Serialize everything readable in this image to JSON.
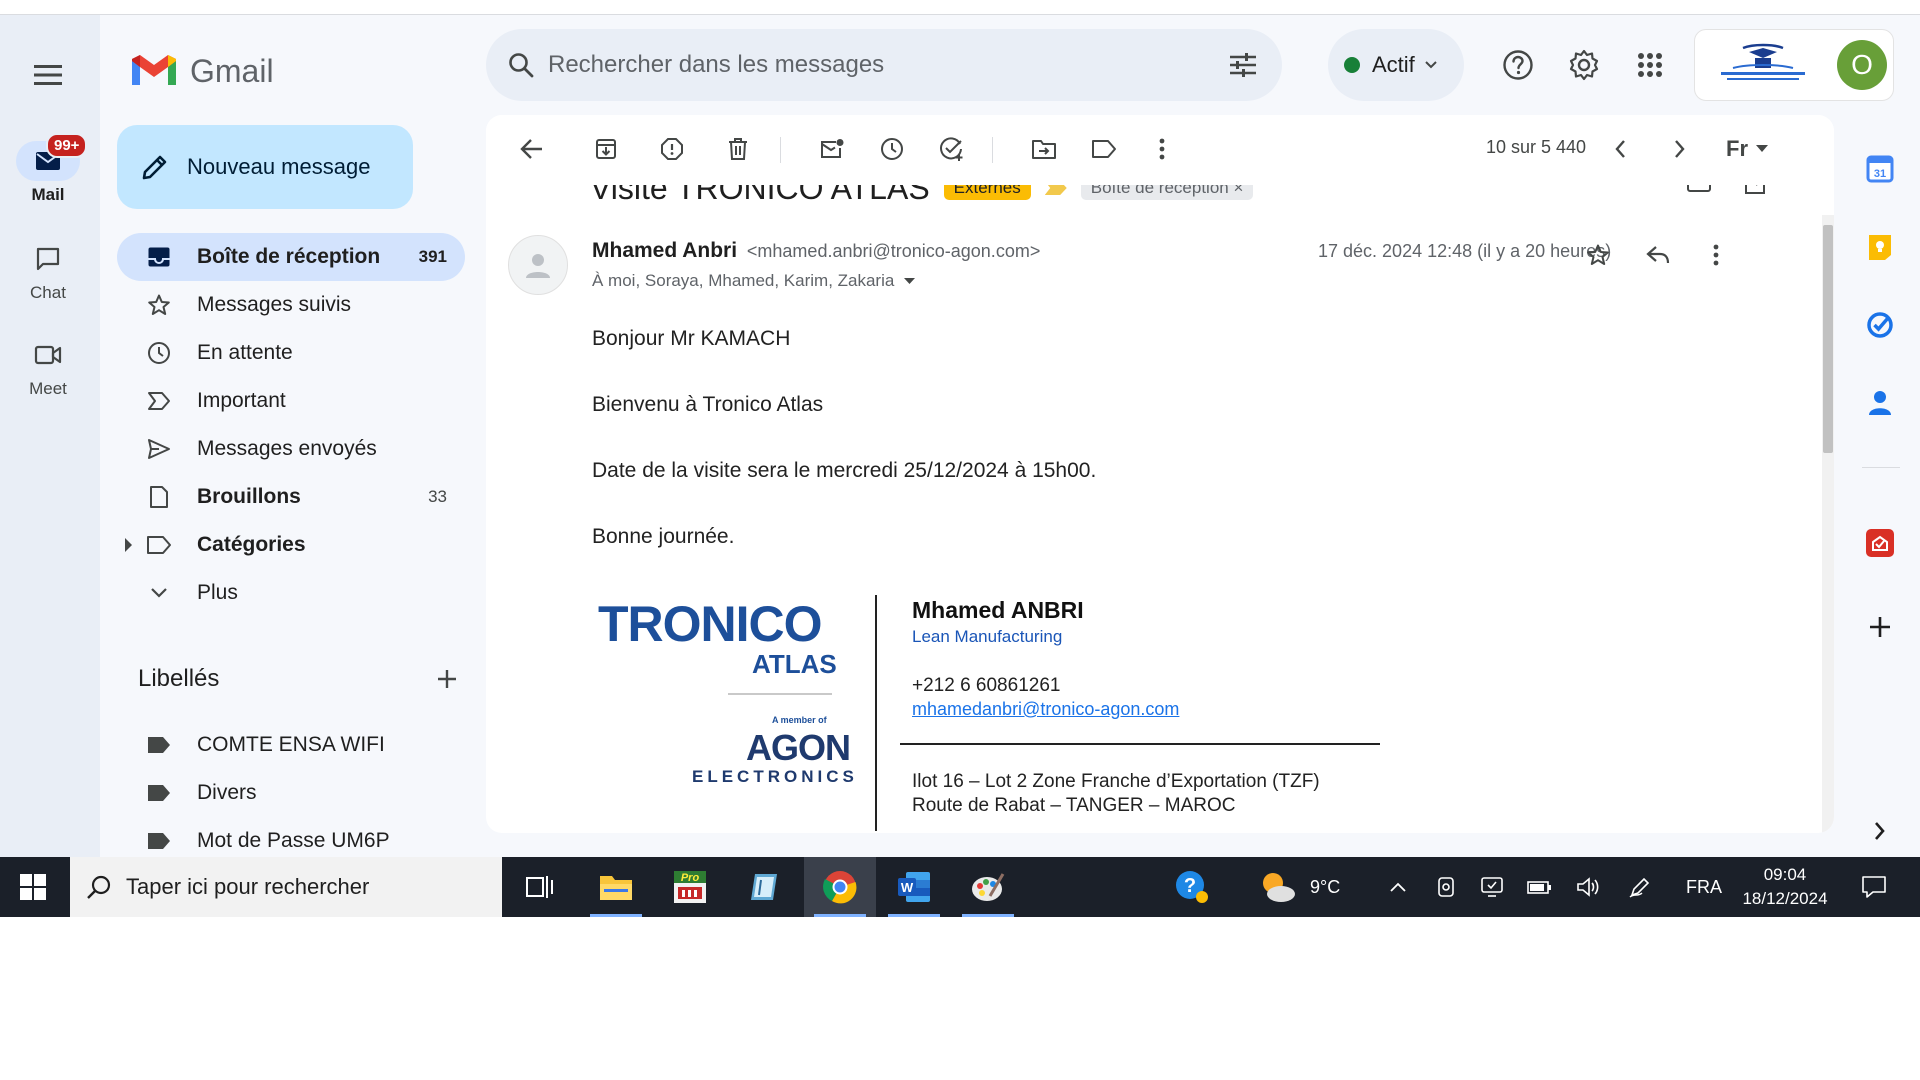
{
  "app": {
    "name": "Gmail"
  },
  "rail": {
    "mail_label": "Mail",
    "mail_badge": "99+",
    "chat_label": "Chat",
    "meet_label": "Meet"
  },
  "search": {
    "placeholder": "Rechercher dans les messages"
  },
  "status": {
    "label": "Actif",
    "color": "#188038"
  },
  "account": {
    "avatar_letter": "O",
    "avatar_color": "#689f38"
  },
  "compose": {
    "label": "Nouveau message"
  },
  "nav": [
    {
      "label": "Boîte de réception",
      "count": "391",
      "icon": "inbox-icon"
    },
    {
      "label": "Messages suivis",
      "count": "",
      "icon": "star-icon"
    },
    {
      "label": "En attente",
      "count": "",
      "icon": "clock-icon"
    },
    {
      "label": "Important",
      "count": "",
      "icon": "important-icon"
    },
    {
      "label": "Messages envoyés",
      "count": "",
      "icon": "send-icon"
    },
    {
      "label": "Brouillons",
      "count": "33",
      "icon": "draft-icon"
    },
    {
      "label": "Catégories",
      "count": "",
      "icon": "label-icon"
    },
    {
      "label": "Plus",
      "count": "",
      "icon": "chevron-down-icon"
    }
  ],
  "labels": {
    "title": "Libellés",
    "items": [
      "COMTE ENSA WIFI",
      "Divers",
      "Mot de Passe UM6P"
    ]
  },
  "toolbar": {
    "page_count": "10 sur 5 440",
    "language": "Fr"
  },
  "message": {
    "subject": "Visite TRONICO ATLAS",
    "chip_external": "Externes",
    "chip_inbox": "Boîte de réception",
    "chip_inbox_close": "×",
    "sender_name": "Mhamed Anbri",
    "sender_email": "<mhamed.anbri@tronico-agon.com>",
    "recipients": "À moi, Soraya, Mhamed, Karim, Zakaria",
    "date": "17 déc. 2024 12:48 (il y a 20 heures)",
    "body": [
      "Bonjour Mr KAMACH",
      "Bienvenu à Tronico Atlas",
      "Date de la visite sera le mercredi 25/12/2024 à 15h00.",
      "Bonne journée."
    ]
  },
  "signature": {
    "company": "TRONICO",
    "company_sub": "ATLAS",
    "member_of": "A member of",
    "group": "AGON",
    "group_sub": "ELECTRONICS",
    "name": "Mhamed ANBRI",
    "role": "Lean Manufacturing",
    "phone": "+212 6 60861261",
    "email": "mhamedanbri@tronico-agon.com",
    "address1": "Ilot 16 – Lot 2 Zone Franche d’Exportation (TZF)",
    "address2": "Route de Rabat – TANGER – MAROC"
  },
  "taskbar": {
    "search_placeholder": "Taper ici pour rechercher",
    "weather": "9°C",
    "language": "FRA",
    "time": "09:04",
    "date": "18/12/2024"
  }
}
